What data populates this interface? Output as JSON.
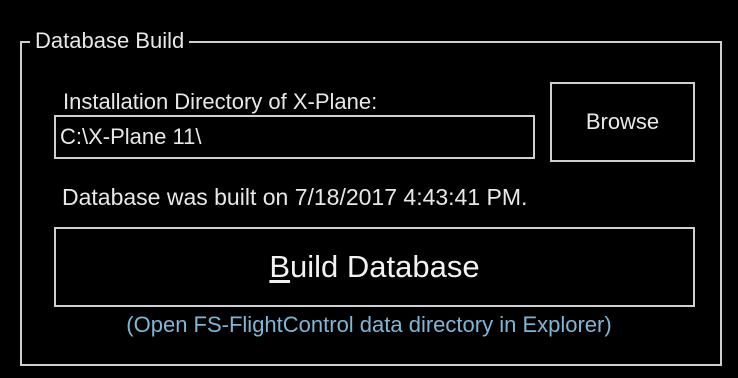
{
  "groupbox": {
    "title": "Database Build"
  },
  "install": {
    "label": "Installation Directory of X-Plane:",
    "path_value": "C:\\X-Plane 11\\",
    "browse_label": "Browse"
  },
  "status": {
    "text": "Database was built on 7/18/2017 4:43:41 PM."
  },
  "build": {
    "mnemonic": "B",
    "label_rest": "uild Database"
  },
  "link": {
    "text": "(Open FS-FlightControl data directory in Explorer)"
  },
  "colors": {
    "background": "#000000",
    "border": "#cfcfcf",
    "text": "#e8e8e8",
    "link": "#7fb6d6"
  }
}
